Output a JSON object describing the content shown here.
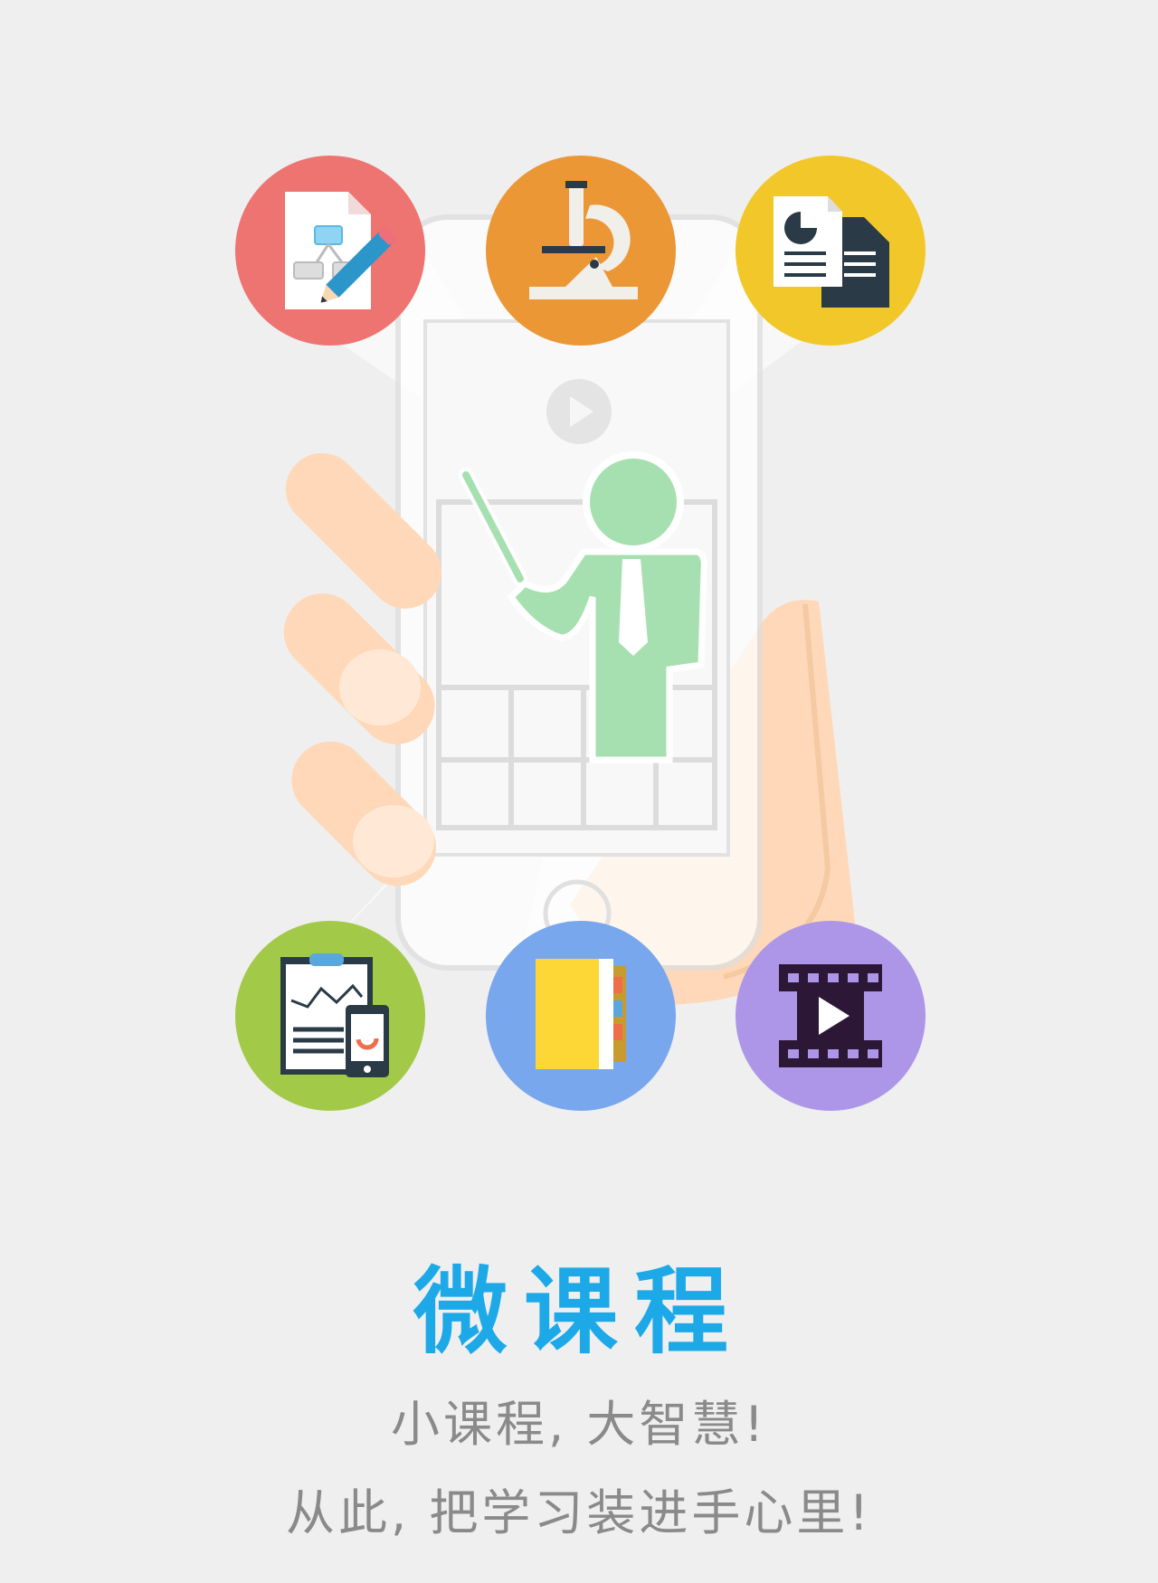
{
  "title": "微课程",
  "subtitle_line1": "小课程, 大智慧!",
  "subtitle_line2": "从此, 把学习装进手心里!",
  "colors": {
    "background": "#efefef",
    "title": "#1da9e8",
    "subtitle": "#8a8a8a",
    "red": "#ee7472",
    "orange": "#eb9736",
    "yellow": "#f2c72a",
    "green": "#a2ca48",
    "blue": "#79a7ee",
    "purple": "#ad96e8",
    "skin": "#fed8b8",
    "figure": "#a7e0b0"
  },
  "icons": [
    "flowchart-edit-icon",
    "microscope-icon",
    "documents-icon",
    "clipboard-chart-icon",
    "notebook-icon",
    "film-play-icon"
  ]
}
